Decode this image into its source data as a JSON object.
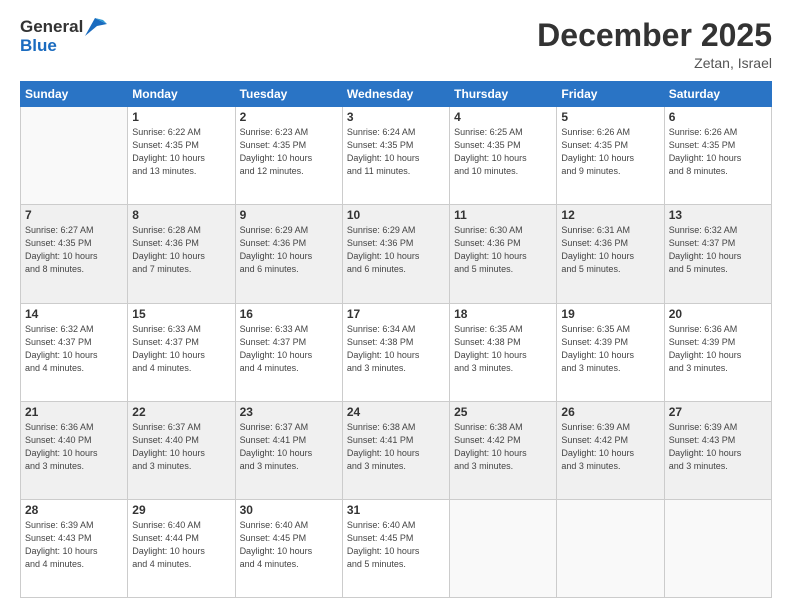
{
  "header": {
    "logo_line1": "General",
    "logo_line2": "Blue",
    "month": "December 2025",
    "location": "Zetan, Israel"
  },
  "days_of_week": [
    "Sunday",
    "Monday",
    "Tuesday",
    "Wednesday",
    "Thursday",
    "Friday",
    "Saturday"
  ],
  "weeks": [
    [
      {
        "day": "",
        "info": ""
      },
      {
        "day": "1",
        "info": "Sunrise: 6:22 AM\nSunset: 4:35 PM\nDaylight: 10 hours\nand 13 minutes."
      },
      {
        "day": "2",
        "info": "Sunrise: 6:23 AM\nSunset: 4:35 PM\nDaylight: 10 hours\nand 12 minutes."
      },
      {
        "day": "3",
        "info": "Sunrise: 6:24 AM\nSunset: 4:35 PM\nDaylight: 10 hours\nand 11 minutes."
      },
      {
        "day": "4",
        "info": "Sunrise: 6:25 AM\nSunset: 4:35 PM\nDaylight: 10 hours\nand 10 minutes."
      },
      {
        "day": "5",
        "info": "Sunrise: 6:26 AM\nSunset: 4:35 PM\nDaylight: 10 hours\nand 9 minutes."
      },
      {
        "day": "6",
        "info": "Sunrise: 6:26 AM\nSunset: 4:35 PM\nDaylight: 10 hours\nand 8 minutes."
      }
    ],
    [
      {
        "day": "7",
        "info": "Sunrise: 6:27 AM\nSunset: 4:35 PM\nDaylight: 10 hours\nand 8 minutes."
      },
      {
        "day": "8",
        "info": "Sunrise: 6:28 AM\nSunset: 4:36 PM\nDaylight: 10 hours\nand 7 minutes."
      },
      {
        "day": "9",
        "info": "Sunrise: 6:29 AM\nSunset: 4:36 PM\nDaylight: 10 hours\nand 6 minutes."
      },
      {
        "day": "10",
        "info": "Sunrise: 6:29 AM\nSunset: 4:36 PM\nDaylight: 10 hours\nand 6 minutes."
      },
      {
        "day": "11",
        "info": "Sunrise: 6:30 AM\nSunset: 4:36 PM\nDaylight: 10 hours\nand 5 minutes."
      },
      {
        "day": "12",
        "info": "Sunrise: 6:31 AM\nSunset: 4:36 PM\nDaylight: 10 hours\nand 5 minutes."
      },
      {
        "day": "13",
        "info": "Sunrise: 6:32 AM\nSunset: 4:37 PM\nDaylight: 10 hours\nand 5 minutes."
      }
    ],
    [
      {
        "day": "14",
        "info": "Sunrise: 6:32 AM\nSunset: 4:37 PM\nDaylight: 10 hours\nand 4 minutes."
      },
      {
        "day": "15",
        "info": "Sunrise: 6:33 AM\nSunset: 4:37 PM\nDaylight: 10 hours\nand 4 minutes."
      },
      {
        "day": "16",
        "info": "Sunrise: 6:33 AM\nSunset: 4:37 PM\nDaylight: 10 hours\nand 4 minutes."
      },
      {
        "day": "17",
        "info": "Sunrise: 6:34 AM\nSunset: 4:38 PM\nDaylight: 10 hours\nand 3 minutes."
      },
      {
        "day": "18",
        "info": "Sunrise: 6:35 AM\nSunset: 4:38 PM\nDaylight: 10 hours\nand 3 minutes."
      },
      {
        "day": "19",
        "info": "Sunrise: 6:35 AM\nSunset: 4:39 PM\nDaylight: 10 hours\nand 3 minutes."
      },
      {
        "day": "20",
        "info": "Sunrise: 6:36 AM\nSunset: 4:39 PM\nDaylight: 10 hours\nand 3 minutes."
      }
    ],
    [
      {
        "day": "21",
        "info": "Sunrise: 6:36 AM\nSunset: 4:40 PM\nDaylight: 10 hours\nand 3 minutes."
      },
      {
        "day": "22",
        "info": "Sunrise: 6:37 AM\nSunset: 4:40 PM\nDaylight: 10 hours\nand 3 minutes."
      },
      {
        "day": "23",
        "info": "Sunrise: 6:37 AM\nSunset: 4:41 PM\nDaylight: 10 hours\nand 3 minutes."
      },
      {
        "day": "24",
        "info": "Sunrise: 6:38 AM\nSunset: 4:41 PM\nDaylight: 10 hours\nand 3 minutes."
      },
      {
        "day": "25",
        "info": "Sunrise: 6:38 AM\nSunset: 4:42 PM\nDaylight: 10 hours\nand 3 minutes."
      },
      {
        "day": "26",
        "info": "Sunrise: 6:39 AM\nSunset: 4:42 PM\nDaylight: 10 hours\nand 3 minutes."
      },
      {
        "day": "27",
        "info": "Sunrise: 6:39 AM\nSunset: 4:43 PM\nDaylight: 10 hours\nand 3 minutes."
      }
    ],
    [
      {
        "day": "28",
        "info": "Sunrise: 6:39 AM\nSunset: 4:43 PM\nDaylight: 10 hours\nand 4 minutes."
      },
      {
        "day": "29",
        "info": "Sunrise: 6:40 AM\nSunset: 4:44 PM\nDaylight: 10 hours\nand 4 minutes."
      },
      {
        "day": "30",
        "info": "Sunrise: 6:40 AM\nSunset: 4:45 PM\nDaylight: 10 hours\nand 4 minutes."
      },
      {
        "day": "31",
        "info": "Sunrise: 6:40 AM\nSunset: 4:45 PM\nDaylight: 10 hours\nand 5 minutes."
      },
      {
        "day": "",
        "info": ""
      },
      {
        "day": "",
        "info": ""
      },
      {
        "day": "",
        "info": ""
      }
    ]
  ]
}
